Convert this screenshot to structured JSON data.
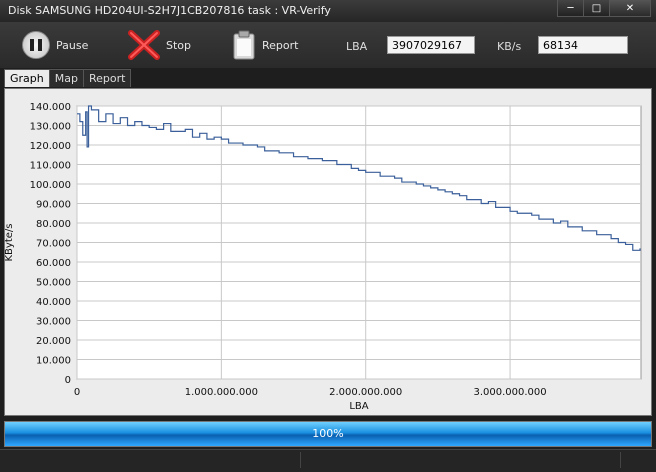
{
  "window": {
    "title": "Disk SAMSUNG HD204UI-S2H7J1CB207816   task : VR-Verify"
  },
  "toolbar": {
    "pause_label": "Pause",
    "stop_label": "Stop",
    "report_label": "Report",
    "lba_label": "LBA",
    "lba_value": "3907029167",
    "kbs_label": "KB/s",
    "kbs_value": "68134"
  },
  "tabs": [
    {
      "label": "Graph",
      "active": true
    },
    {
      "label": "Map",
      "active": false
    },
    {
      "label": "Report",
      "active": false
    }
  ],
  "progress": {
    "label": "100%",
    "fraction": 1.0
  },
  "colors": {
    "series": "#3a5f9a",
    "grid": "#c8c8c8",
    "progress": "#1a8fe0"
  },
  "chart_data": {
    "type": "line",
    "xlabel": "LBA",
    "ylabel": "KByte/s",
    "xlim": [
      0,
      3907029167
    ],
    "ylim": [
      0,
      140000
    ],
    "x_ticks": [
      {
        "value": 0,
        "label": "0"
      },
      {
        "value": 1000000000,
        "label": "1.000.000.000"
      },
      {
        "value": 2000000000,
        "label": "2.000.000.000"
      },
      {
        "value": 3000000000,
        "label": "3.000.000.000"
      }
    ],
    "y_ticks": [
      {
        "value": 0,
        "label": "0"
      },
      {
        "value": 10000,
        "label": "10.000"
      },
      {
        "value": 20000,
        "label": "20.000"
      },
      {
        "value": 30000,
        "label": "30.000"
      },
      {
        "value": 40000,
        "label": "40.000"
      },
      {
        "value": 50000,
        "label": "50.000"
      },
      {
        "value": 60000,
        "label": "60.000"
      },
      {
        "value": 70000,
        "label": "70.000"
      },
      {
        "value": 80000,
        "label": "80.000"
      },
      {
        "value": 90000,
        "label": "90.000"
      },
      {
        "value": 100000,
        "label": "100.000"
      },
      {
        "value": 110000,
        "label": "110.000"
      },
      {
        "value": 120000,
        "label": "120.000"
      },
      {
        "value": 130000,
        "label": "130.000"
      },
      {
        "value": 140000,
        "label": "140.000"
      }
    ],
    "grid": true,
    "series": [
      {
        "x": [
          0,
          20000000,
          40000000,
          60000000,
          70000000,
          80000000,
          100000000,
          150000000,
          200000000,
          250000000,
          300000000,
          350000000,
          400000000,
          450000000,
          500000000,
          550000000,
          600000000,
          650000000,
          700000000,
          750000000,
          800000000,
          850000000,
          900000000,
          950000000,
          1000000000,
          1050000000,
          1100000000,
          1150000000,
          1200000000,
          1250000000,
          1300000000,
          1350000000,
          1400000000,
          1450000000,
          1500000000,
          1550000000,
          1600000000,
          1650000000,
          1700000000,
          1750000000,
          1800000000,
          1850000000,
          1900000000,
          1950000000,
          2000000000,
          2050000000,
          2100000000,
          2150000000,
          2200000000,
          2250000000,
          2300000000,
          2350000000,
          2400000000,
          2450000000,
          2500000000,
          2550000000,
          2600000000,
          2650000000,
          2700000000,
          2750000000,
          2800000000,
          2850000000,
          2900000000,
          2950000000,
          3000000000,
          3050000000,
          3100000000,
          3150000000,
          3200000000,
          3250000000,
          3300000000,
          3350000000,
          3400000000,
          3450000000,
          3500000000,
          3550000000,
          3600000000,
          3650000000,
          3700000000,
          3750000000,
          3800000000,
          3850000000,
          3900000000
        ],
        "y": [
          136000,
          132000,
          125000,
          137000,
          119000,
          140000,
          138000,
          132000,
          136000,
          131000,
          134000,
          130000,
          132000,
          130000,
          129000,
          128000,
          131000,
          127000,
          127000,
          128000,
          124000,
          126000,
          123000,
          124000,
          123000,
          121000,
          121000,
          120000,
          120000,
          119000,
          117000,
          117000,
          116000,
          116000,
          114000,
          114000,
          113000,
          113000,
          112000,
          112000,
          110000,
          110000,
          108000,
          107000,
          106000,
          106000,
          104000,
          104000,
          103000,
          101000,
          101000,
          100000,
          99000,
          98000,
          97000,
          96000,
          95000,
          94000,
          92000,
          92000,
          90000,
          91000,
          88000,
          88000,
          86000,
          85000,
          85000,
          84000,
          82000,
          82000,
          80000,
          81000,
          78000,
          78000,
          76000,
          76000,
          74000,
          74000,
          72000,
          70000,
          69000,
          66000,
          67000
        ]
      }
    ]
  }
}
